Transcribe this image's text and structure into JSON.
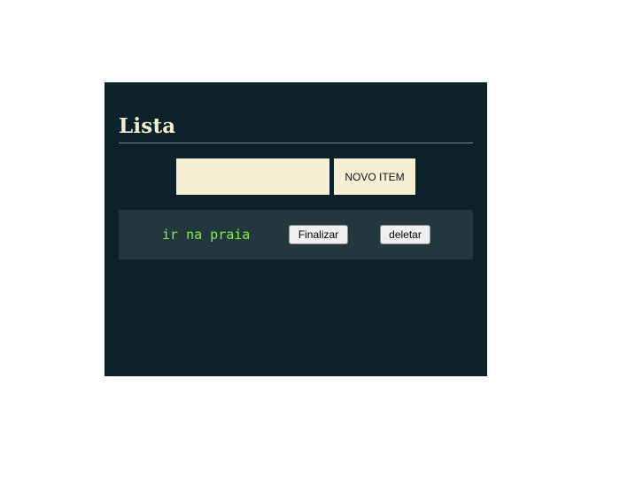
{
  "header": {
    "title": "Lista"
  },
  "new_item": {
    "input_value": "",
    "input_placeholder": "",
    "button_label": "NOVO ITEM"
  },
  "items": [
    {
      "text": "ir na praia",
      "finish_label": "Finalizar",
      "delete_label": "deletar"
    }
  ],
  "colors": {
    "panel_background": "#0c2129",
    "title": "#f4eccd",
    "input_background": "#f5efd3",
    "item_row_background": "#23383e",
    "item_text": "#82ef45"
  }
}
